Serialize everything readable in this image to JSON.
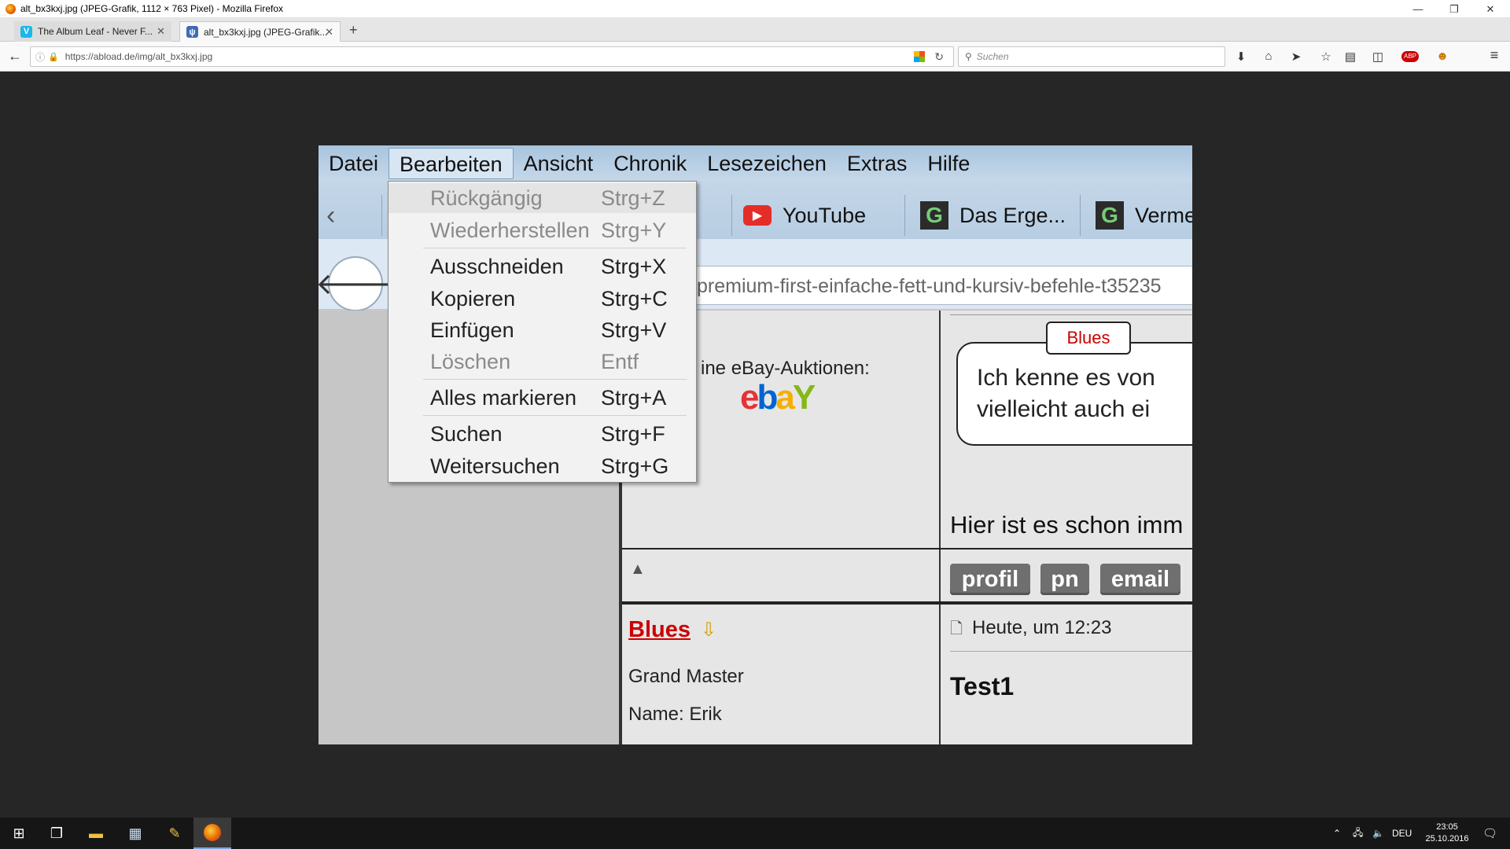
{
  "window": {
    "title": "alt_bx3kxj.jpg (JPEG-Grafik, 1112 × 763 Pixel) - Mozilla Firefox",
    "minimize": "—",
    "restore": "❐",
    "close": "✕"
  },
  "tabs": [
    {
      "label": "The Album Leaf - Never F...",
      "favicon": "V",
      "favicon_color": "#1ab7ea"
    },
    {
      "label": "alt_bx3kxj.jpg (JPEG-Grafik...",
      "favicon": "ψ",
      "favicon_color": "#3b6db5"
    }
  ],
  "navbar": {
    "url": "https://abload.de/img/alt_bx3kxj.jpg",
    "search_placeholder": "Suchen"
  },
  "screenshot": {
    "menu": [
      "Datei",
      "Bearbeiten",
      "Ansicht",
      "Chronik",
      "Lesezeichen",
      "Extras",
      "Hilfe"
    ],
    "tabs": [
      "YouTube",
      "Das Erge...",
      "Verme"
    ],
    "url_fragment": "premium-first-einfache-fett-und-kursiv-befehle-t35235",
    "dropdown": [
      {
        "label": "Rückgängig",
        "shortcut": "Strg+Z",
        "disabled": true
      },
      {
        "label": "Wiederherstellen",
        "shortcut": "Strg+Y",
        "disabled": true
      },
      {
        "label": "Ausschneiden",
        "shortcut": "Strg+X",
        "disabled": false
      },
      {
        "label": "Kopieren",
        "shortcut": "Strg+C",
        "disabled": false
      },
      {
        "label": "Einfügen",
        "shortcut": "Strg+V",
        "disabled": false
      },
      {
        "label": "Löschen",
        "shortcut": "Entf",
        "disabled": true
      },
      {
        "label": "Alles markieren",
        "shortcut": "Strg+A",
        "disabled": false
      },
      {
        "label": "Suchen",
        "shortcut": "Strg+F",
        "disabled": false
      },
      {
        "label": "Weitersuchen",
        "shortcut": "Strg+G",
        "disabled": false
      }
    ],
    "ebay_text": "ine eBay-Auktionen:",
    "ebay_logo": {
      "e": "e",
      "b": "b",
      "a": "a",
      "y": "Y"
    },
    "bubble_tag": "Blues",
    "bubble_text_1": "Ich kenne es von",
    "bubble_text_2": "vielleicht auch ei",
    "post_text": "Hier ist es schon imm",
    "buttons": [
      "profil",
      "pn",
      "email"
    ],
    "up_arrow": "▲",
    "user_name": "Blues",
    "user_rank": "Grand Master",
    "user_realname": "Name: Erik",
    "post_time": "Heute, um 12:23",
    "post_title": "Test1"
  },
  "taskbar": {
    "lang": "DEU",
    "time": "23:05",
    "date": "25.10.2016"
  }
}
